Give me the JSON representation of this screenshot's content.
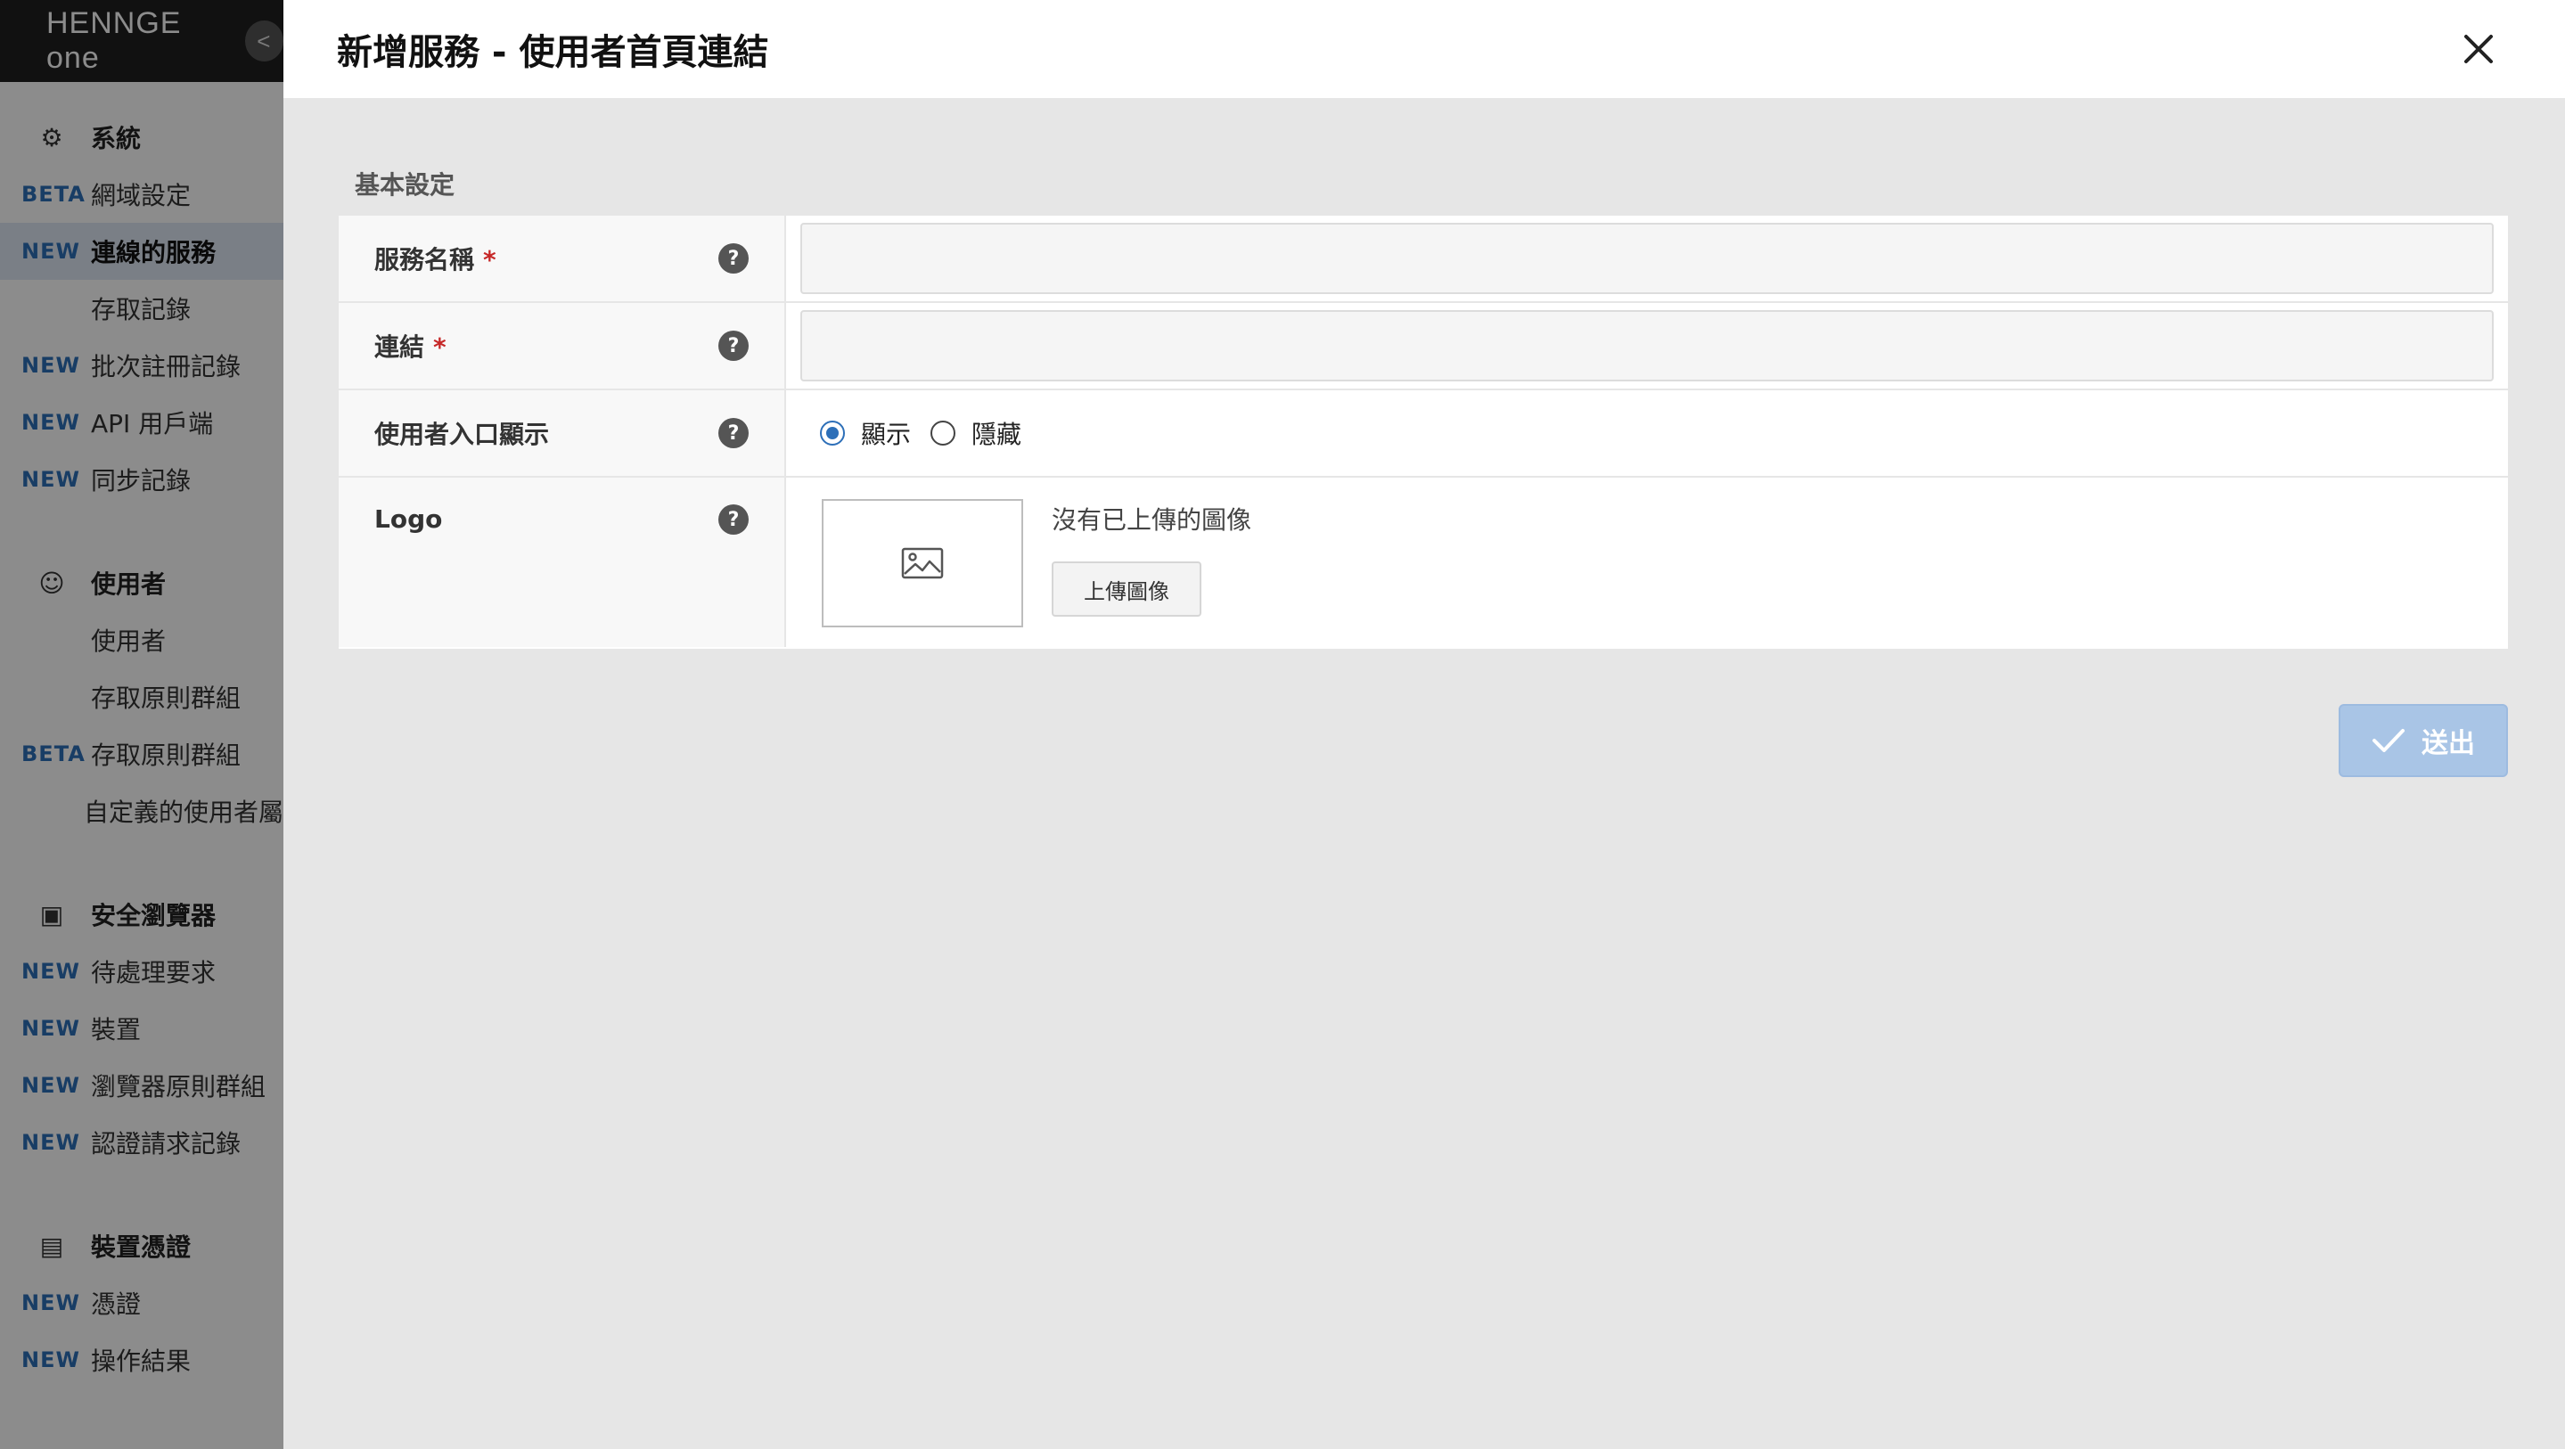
{
  "brand": {
    "name": "HENNGE one"
  },
  "sidebar": {
    "sections": [
      {
        "title": "系統",
        "icon": "gear-icon",
        "items": [
          {
            "badge": "BETA",
            "label": "網域設定",
            "active": false
          },
          {
            "badge": "NEW",
            "label": "連線的服務",
            "active": true
          },
          {
            "badge": "",
            "label": "存取記錄",
            "active": false
          },
          {
            "badge": "NEW",
            "label": "批次註冊記錄",
            "active": false
          },
          {
            "badge": "NEW",
            "label": "API 用戶端",
            "active": false
          },
          {
            "badge": "NEW",
            "label": "同步記錄",
            "active": false
          }
        ]
      },
      {
        "title": "使用者",
        "icon": "users-icon",
        "items": [
          {
            "badge": "",
            "label": "使用者",
            "active": false
          },
          {
            "badge": "",
            "label": "存取原則群組",
            "active": false
          },
          {
            "badge": "BETA",
            "label": "存取原則群組",
            "active": false
          },
          {
            "badge": "",
            "label": "自定義的使用者屬",
            "active": false
          }
        ]
      },
      {
        "title": "安全瀏覽器",
        "icon": "browser-icon",
        "items": [
          {
            "badge": "NEW",
            "label": "待處理要求",
            "active": false
          },
          {
            "badge": "NEW",
            "label": "裝置",
            "active": false
          },
          {
            "badge": "NEW",
            "label": "瀏覽器原則群組",
            "active": false
          },
          {
            "badge": "NEW",
            "label": "認證請求記錄",
            "active": false
          }
        ]
      },
      {
        "title": "裝置憑證",
        "icon": "certificate-icon",
        "items": [
          {
            "badge": "NEW",
            "label": "憑證",
            "active": false
          },
          {
            "badge": "NEW",
            "label": "操作結果",
            "active": false
          }
        ]
      }
    ]
  },
  "dialog": {
    "title": "新增服務 - 使用者首頁連結",
    "section_title": "基本設定",
    "fields": {
      "service_name": {
        "label": "服務名稱",
        "required": "*",
        "value": ""
      },
      "link": {
        "label": "連結",
        "required": "*",
        "value": ""
      },
      "portal_display": {
        "label": "使用者入口顯示",
        "options": [
          "顯示",
          "隱藏"
        ],
        "selected": "顯示"
      },
      "logo": {
        "label": "Logo",
        "no_image_text": "沒有已上傳的圖像",
        "upload_label": "上傳圖像"
      }
    },
    "submit_label": "送出",
    "colors": {
      "accent": "#2d6fb8",
      "submit_disabled": "#a9c5e6",
      "required": "#c62828"
    }
  }
}
